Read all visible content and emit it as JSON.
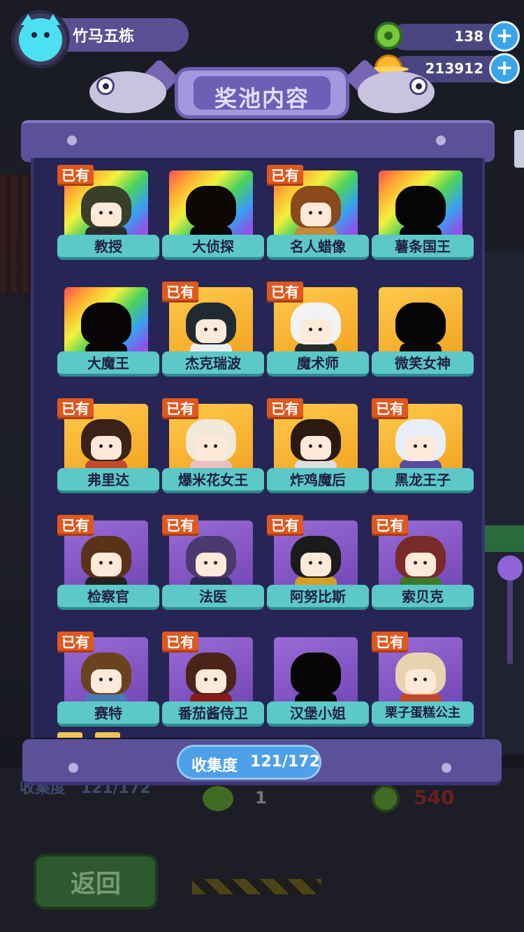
{
  "player": {
    "name": "竹马五栋"
  },
  "currencies": [
    {
      "icon": "donut-coin-icon",
      "value": "138"
    },
    {
      "icon": "golden-planet-icon",
      "value": "213912"
    }
  ],
  "modal": {
    "title": "奖池内容",
    "owned_badge": "已有",
    "collection_label": "收集度",
    "collection_value": "121/172",
    "collection_fraction": 0.703,
    "items": [
      {
        "name": "教授",
        "owned": true,
        "frame": "rainbow"
      },
      {
        "name": "大侦探",
        "owned": false,
        "frame": "rainbow"
      },
      {
        "name": "名人蜡像",
        "owned": true,
        "frame": "rainbow"
      },
      {
        "name": "薯条国王",
        "owned": false,
        "frame": "rainbow"
      },
      {
        "name": "大魔王",
        "owned": false,
        "frame": "rainbow"
      },
      {
        "name": "杰克瑞波",
        "owned": true,
        "frame": "gold"
      },
      {
        "name": "魔术师",
        "owned": true,
        "frame": "gold"
      },
      {
        "name": "微笑女神",
        "owned": false,
        "frame": "gold"
      },
      {
        "name": "弗里达",
        "owned": true,
        "frame": "gold"
      },
      {
        "name": "爆米花女王",
        "owned": true,
        "frame": "gold"
      },
      {
        "name": "炸鸡魔后",
        "owned": true,
        "frame": "gold"
      },
      {
        "name": "黑龙王子",
        "owned": true,
        "frame": "gold"
      },
      {
        "name": "检察官",
        "owned": true,
        "frame": "purple"
      },
      {
        "name": "法医",
        "owned": true,
        "frame": "purple"
      },
      {
        "name": "阿努比斯",
        "owned": true,
        "frame": "purple"
      },
      {
        "name": "索贝克",
        "owned": true,
        "frame": "purple"
      },
      {
        "name": "赛特",
        "owned": true,
        "frame": "purple"
      },
      {
        "name": "番茄酱侍卫",
        "owned": true,
        "frame": "purple"
      },
      {
        "name": "汉堡小姐",
        "owned": false,
        "frame": "purple"
      },
      {
        "name": "栗子蛋糕公主",
        "owned": true,
        "frame": "purple"
      }
    ]
  },
  "background": {
    "collection_label": "收集度",
    "collection_value": "121/172",
    "count_left": "1",
    "count_right": "540",
    "back_button": "返回"
  }
}
